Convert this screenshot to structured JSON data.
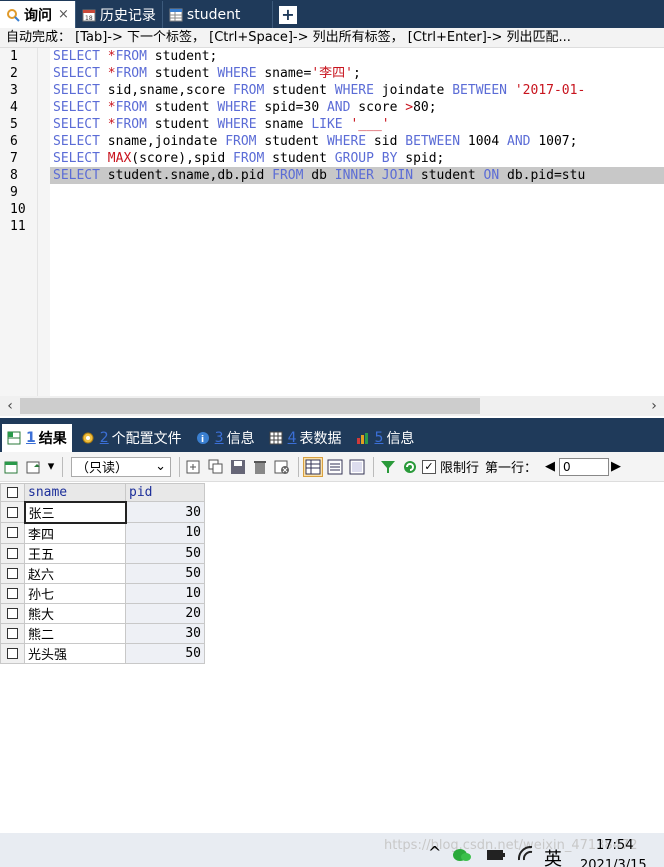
{
  "tabs": [
    {
      "label": "询问",
      "close": "×",
      "icon": "query-icon"
    },
    {
      "label": "历史记录",
      "icon": "history-icon"
    },
    {
      "label": "student",
      "icon": "table-icon"
    }
  ],
  "new_tab": "+",
  "autocomplete_hint": "自动完成： [Tab]-> 下一个标签， [Ctrl+Space]-> 列出所有标签， [Ctrl+Enter]-> 列出匹配...",
  "line_numbers": [
    "1",
    "2",
    "3",
    "4",
    "5",
    "6",
    "7",
    "8",
    "9",
    "10",
    "11"
  ],
  "sql_lines": [
    "SELECT *FROM student;",
    "SELECT *FROM student WHERE sname='李四';",
    "SELECT sid,sname,score FROM student WHERE joindate BETWEEN '2017-01-",
    "SELECT *FROM student WHERE spid=30 AND score >80;",
    "SELECT *FROM student WHERE sname LIKE '___'",
    "SELECT sname,joindate FROM student WHERE sid BETWEEN 1004 AND 1007;",
    "SELECT MAX(score),spid FROM student GROUP BY spid;",
    "SELECT student.sname,db.pid FROM db INNER JOIN student ON db.pid=stu"
  ],
  "scroll_left": "‹",
  "scroll_right": "›",
  "result_tabs": [
    {
      "num": "1",
      "label": "结果",
      "icon": "grid-result-icon"
    },
    {
      "num": "2",
      "label": "个配置文件",
      "icon": "profile-icon"
    },
    {
      "num": "3",
      "label": "信息",
      "icon": "info-icon"
    },
    {
      "num": "4",
      "label": "表数据",
      "icon": "table-data-icon"
    },
    {
      "num": "5",
      "label": "信息",
      "icon": "info-chart-icon"
    }
  ],
  "toolbar": {
    "mode_select": "（只读）",
    "limit_label": "限制行",
    "first_row_label": "第一行：",
    "first_row_value": "0"
  },
  "grid": {
    "columns": [
      "sname",
      "pid"
    ],
    "rows": [
      {
        "sname": "张三",
        "pid": "30"
      },
      {
        "sname": "李四",
        "pid": "10"
      },
      {
        "sname": "王五",
        "pid": "50"
      },
      {
        "sname": "赵六",
        "pid": "50"
      },
      {
        "sname": "孙七",
        "pid": "10"
      },
      {
        "sname": "熊大",
        "pid": "20"
      },
      {
        "sname": "熊二",
        "pid": "30"
      },
      {
        "sname": "光头强",
        "pid": "50"
      }
    ]
  },
  "taskbar": {
    "watermark": "https://blog.csdn.net/weixin_47138472",
    "time": "17:54",
    "date": "2021/3/15",
    "ime": "英"
  },
  "colors": {
    "tab_bar": "#1f3a5a",
    "keyword": "#5b6cd6",
    "string": "#c8141e",
    "highlight": "#c8c8c8"
  }
}
